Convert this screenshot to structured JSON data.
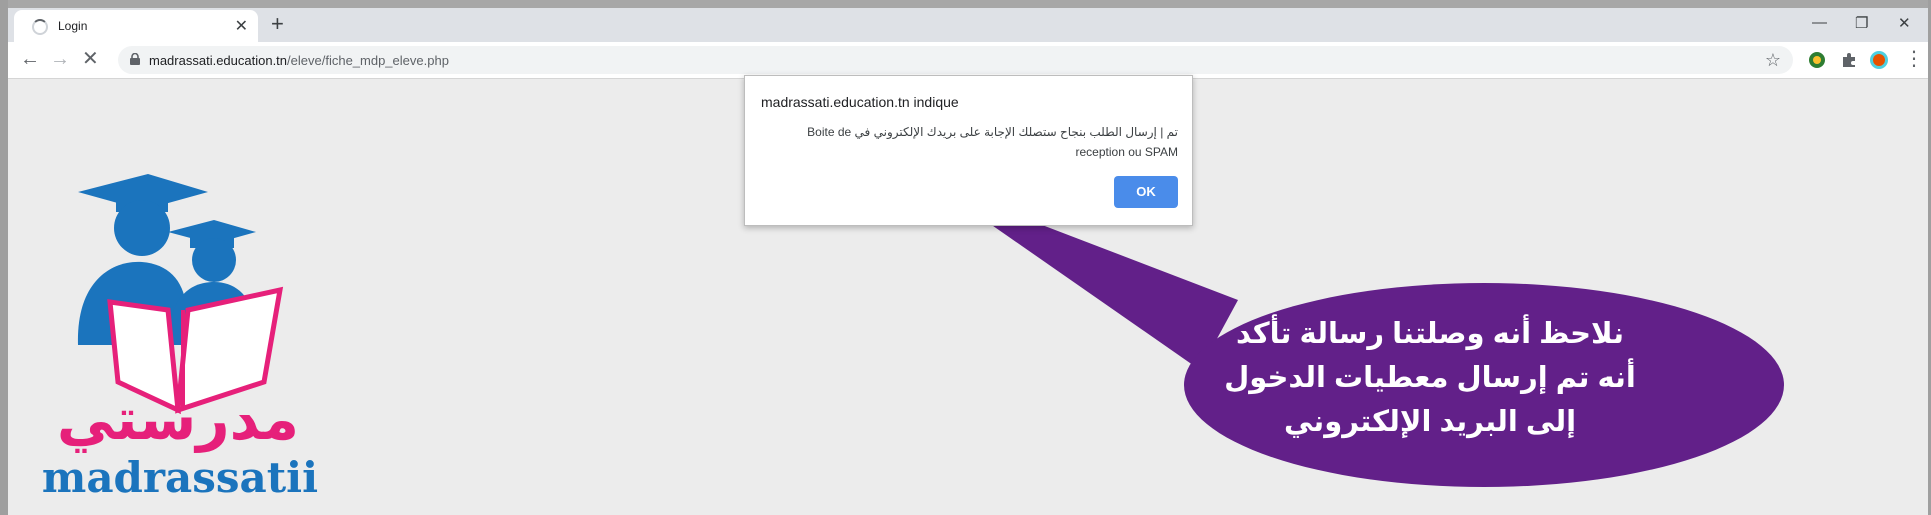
{
  "browser": {
    "tab_title": "Login",
    "new_tab_symbol": "+",
    "close_tab_symbol": "✕",
    "window_controls": {
      "minimize": "—",
      "restore": "❐",
      "close": "✕"
    },
    "url_host": "madrassati.education.tn",
    "url_path": "/eleve/fiche_mdp_eleve.php",
    "colors": {
      "accent": "#4a8cea",
      "tab_strip": "#dee1e6"
    }
  },
  "dialog": {
    "header": "madrassati.education.tn indique",
    "message": "تم | إرسال الطلب بنجاح ستصلك الإجابة على بريدك الإلكتروني في  Boite de reception ou SPAM",
    "ok_label": "OK"
  },
  "logo": {
    "arabic": "مدرستي",
    "latin": "madrassatii",
    "colors": {
      "blue": "#1b74bd",
      "pink": "#e6207a"
    }
  },
  "callout": {
    "text": "نلاحظ أنه وصلتنا رسالة تأكد أنه تم إرسال معطيات الدخول إلى البريد الإلكتروني",
    "color": "#622089"
  }
}
